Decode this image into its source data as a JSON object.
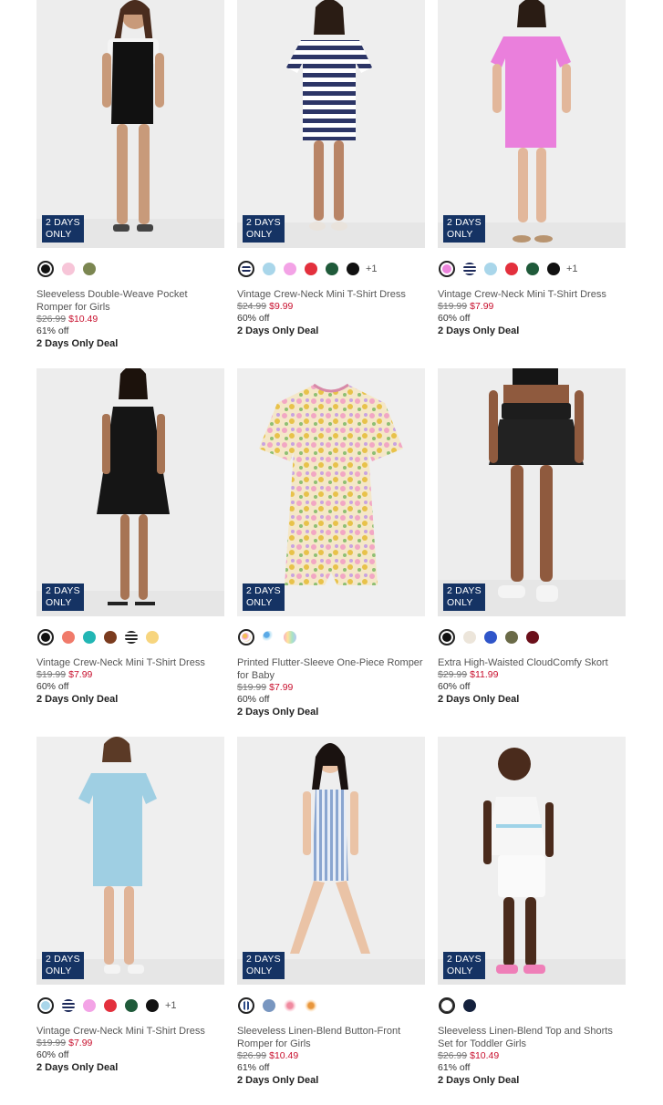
{
  "badge_line1": "2 DAYS",
  "badge_line2": "ONLY",
  "products": [
    {
      "name": "Sleeveless Double-Weave Pocket Romper for Girls",
      "old_price": "$26.99",
      "new_price": "$10.49",
      "discount": "61% off",
      "deal": "2 Days Only Deal",
      "more": "",
      "swatches": [
        "#111111",
        "#f7c5d8",
        "#7b8651"
      ],
      "figure": "black-romper"
    },
    {
      "name": "Vintage Crew-Neck Mini T-Shirt Dress",
      "old_price": "$24.99",
      "new_price": "$9.99",
      "discount": "60% off",
      "deal": "2 Days Only Deal",
      "more": "+1",
      "swatches": [
        "stripe-navy",
        "#a9d6ea",
        "#f3a3e6",
        "#e3303d",
        "#1f5a3a",
        "#111111"
      ],
      "figure": "stripe-dress"
    },
    {
      "name": "Vintage Crew-Neck Mini T-Shirt Dress",
      "old_price": "$19.99",
      "new_price": "$7.99",
      "discount": "60% off",
      "deal": "2 Days Only Deal",
      "more": "+1",
      "swatches": [
        "#ec84dc",
        "stripe-navy",
        "#a9d6ea",
        "#e3303d",
        "#1f5a3a",
        "#111111"
      ],
      "figure": "pink-dress"
    },
    {
      "name": "Vintage Crew-Neck Mini T-Shirt Dress",
      "old_price": "$19.99",
      "new_price": "$7.99",
      "discount": "60% off",
      "deal": "2 Days Only Deal",
      "more": "",
      "swatches": [
        "#111111",
        "#f07a6a",
        "#22b6b4",
        "#7a3b1e",
        "stripe-black",
        "#f7d57e"
      ],
      "figure": "black-dress"
    },
    {
      "name": "Printed Flutter-Sleeve One-Piece Romper for Baby",
      "old_price": "$19.99",
      "new_price": "$7.99",
      "discount": "60% off",
      "deal": "2 Days Only Deal",
      "more": "",
      "swatches": [
        "floral",
        "print-blue",
        "print-rainbow"
      ],
      "figure": "floral-romper"
    },
    {
      "name": "Extra High-Waisted CloudComfy Skort",
      "old_price": "$29.99",
      "new_price": "$11.99",
      "discount": "60% off",
      "deal": "2 Days Only Deal",
      "more": "",
      "swatches": [
        "#111111",
        "#ece5da",
        "#2f55c9",
        "#6a6a47",
        "#6b0f1a"
      ],
      "figure": "black-skort"
    },
    {
      "name": "Vintage Crew-Neck Mini T-Shirt Dress",
      "old_price": "$19.99",
      "new_price": "$7.99",
      "discount": "60% off",
      "deal": "2 Days Only Deal",
      "more": "+1",
      "swatches": [
        "#a9d6ea",
        "stripe-navy",
        "#f3a3e6",
        "#e3303d",
        "#1f5a3a",
        "#111111"
      ],
      "figure": "blue-dress"
    },
    {
      "name": "Sleeveless Linen-Blend Button-Front Romper for Girls",
      "old_price": "$26.99",
      "new_price": "$10.49",
      "discount": "61% off",
      "deal": "2 Days Only Deal",
      "more": "",
      "swatches": [
        "stripe-blue",
        "#7896c0",
        "print-pink",
        "print-orange"
      ],
      "figure": "linen-romper"
    },
    {
      "name": "Sleeveless Linen-Blend Top and Shorts Set for Toddler Girls",
      "old_price": "$26.99",
      "new_price": "$10.49",
      "discount": "61% off",
      "deal": "2 Days Only Deal",
      "more": "",
      "swatches": [
        "#ffffff",
        "#14213d"
      ],
      "figure": "toddler-set"
    }
  ]
}
